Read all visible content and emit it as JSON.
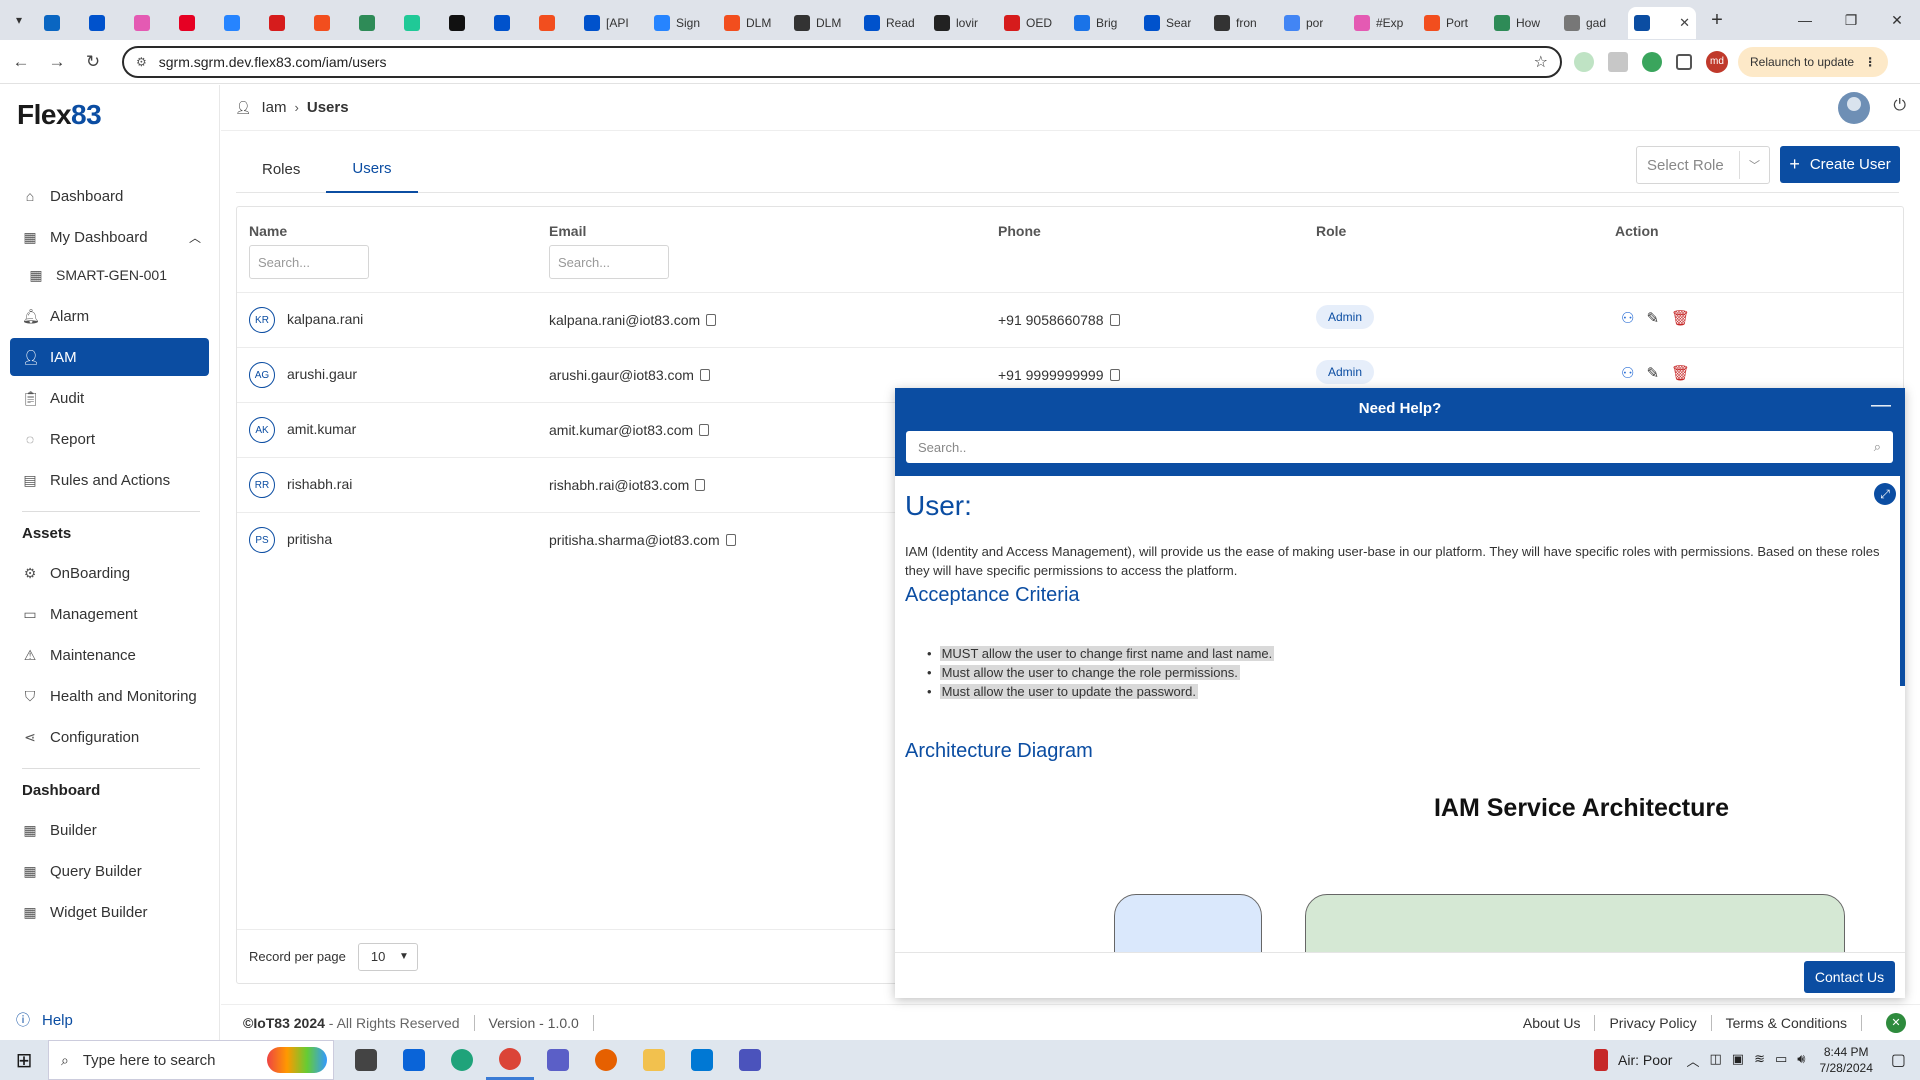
{
  "browser": {
    "tabs": [
      {
        "label": "",
        "color": "#0a66c2"
      },
      {
        "label": "",
        "color": "#0052cc"
      },
      {
        "label": "",
        "color": "#e45ab3"
      },
      {
        "label": "",
        "color": "#e60023"
      },
      {
        "label": "",
        "color": "#2684ff"
      },
      {
        "label": "",
        "color": "#d61c1c"
      },
      {
        "label": "",
        "color": "#f24e1e"
      },
      {
        "label": "",
        "color": "#2e8b57"
      },
      {
        "label": "",
        "color": "#20c997"
      },
      {
        "label": "",
        "color": "#111111"
      },
      {
        "label": "",
        "color": "#0052cc"
      },
      {
        "label": "",
        "color": "#f24e1e"
      },
      {
        "label": "[API",
        "color": "#0052cc"
      },
      {
        "label": "Sign",
        "color": "#2684ff"
      },
      {
        "label": "DLM",
        "color": "#f24e1e"
      },
      {
        "label": "DLM",
        "color": "#333333"
      },
      {
        "label": "Read",
        "color": "#0052cc"
      },
      {
        "label": "lovir",
        "color": "#222222"
      },
      {
        "label": "OED",
        "color": "#d61c1c"
      },
      {
        "label": "Brig",
        "color": "#1a73e8"
      },
      {
        "label": "Sear",
        "color": "#0052cc"
      },
      {
        "label": "fron",
        "color": "#333333"
      },
      {
        "label": "por",
        "color": "#4285f4"
      },
      {
        "label": "#Exp",
        "color": "#e45ab3"
      },
      {
        "label": "Port",
        "color": "#f24e1e"
      },
      {
        "label": "How",
        "color": "#2e8b57"
      },
      {
        "label": "gad",
        "color": "#777777"
      }
    ],
    "active_tab_label": "",
    "url": "sgrm.sgrm.dev.flex83.com/iam/users",
    "profile_initials": "md",
    "relaunch_label": "Relaunch to update"
  },
  "app": {
    "logo_main": "Flex",
    "logo_accent": "83",
    "nav": {
      "dashboard": "Dashboard",
      "my_dashboard": "My Dashboard",
      "smart_gen": "SMART-GEN-001",
      "alarm": "Alarm",
      "iam": "IAM",
      "audit": "Audit",
      "report": "Report",
      "rules": "Rules and Actions",
      "assets_heading": "Assets",
      "onboarding": "OnBoarding",
      "management": "Management",
      "maintenance": "Maintenance",
      "health": "Health and Monitoring",
      "configuration": "Configuration",
      "dashboard_heading": "Dashboard",
      "builder": "Builder",
      "query_builder": "Query Builder",
      "widget_builder": "Widget Builder",
      "help": "Help"
    },
    "breadcrumb": {
      "parent": "Iam",
      "current": "Users"
    },
    "tabs": {
      "roles": "Roles",
      "users": "Users"
    },
    "select_role_placeholder": "Select Role",
    "create_user_label": "Create User",
    "table": {
      "headers": {
        "name": "Name",
        "email": "Email",
        "phone": "Phone",
        "role": "Role",
        "action": "Action"
      },
      "search_placeholder": "Search...",
      "rows": [
        {
          "initials": "KR",
          "name": "kalpana.rani",
          "email": "kalpana.rani@iot83.com",
          "phone": "+91 9058660788",
          "role": "Admin"
        },
        {
          "initials": "AG",
          "name": "arushi.gaur",
          "email": "arushi.gaur@iot83.com",
          "phone": "+91 9999999999",
          "role": "Admin"
        },
        {
          "initials": "AK",
          "name": "amit.kumar",
          "email": "amit.kumar@iot83.com",
          "phone": "",
          "role": ""
        },
        {
          "initials": "RR",
          "name": "rishabh.rai",
          "email": "rishabh.rai@iot83.com",
          "phone": "",
          "role": ""
        },
        {
          "initials": "PS",
          "name": "pritisha",
          "email": "pritisha.sharma@iot83.com",
          "phone": "",
          "role": ""
        }
      ],
      "records_label": "Record per page",
      "records_value": "10"
    },
    "footer": {
      "copyright_brand": "©IoT83 2024",
      "copyright_rest": " - All Rights Reserved",
      "version": "Version - 1.0.0",
      "about": "About Us",
      "privacy": "Privacy Policy",
      "terms": "Terms & Conditions"
    }
  },
  "help_panel": {
    "title": "Need Help?",
    "search_placeholder": "Search..",
    "heading": "User:",
    "intro": "IAM (Identity and Access Management), will provide us the ease of making user-base in our platform. They will have specific roles with permissions. Based on these roles they will have specific permissions to access the platform.",
    "acceptance_heading": "Acceptance Criteria",
    "criteria": [
      "MUST allow the user to change first name and last name.",
      "Must allow the user to change the role permissions.",
      "Must allow the user to update the password."
    ],
    "architecture_heading": "Architecture Diagram",
    "diagram_title": "IAM Service Architecture",
    "contact_label": "Contact Us"
  },
  "taskbar": {
    "search_placeholder": "Type here to search",
    "air_quality": "Air: Poor",
    "time": "8:44 PM",
    "date": "7/28/2024",
    "apps": [
      {
        "name": "task-view",
        "color": "#444444"
      },
      {
        "name": "mail",
        "color": "#0a64d8"
      },
      {
        "name": "edge",
        "color": "#1fa37a"
      },
      {
        "name": "chrome",
        "color": "#db4437"
      },
      {
        "name": "teams",
        "color": "#5b5fc7"
      },
      {
        "name": "firefox",
        "color": "#e66000"
      },
      {
        "name": "file-explorer",
        "color": "#f2c14e"
      },
      {
        "name": "vscode",
        "color": "#0078d4"
      },
      {
        "name": "teams-classic",
        "color": "#4b53bc"
      }
    ]
  }
}
